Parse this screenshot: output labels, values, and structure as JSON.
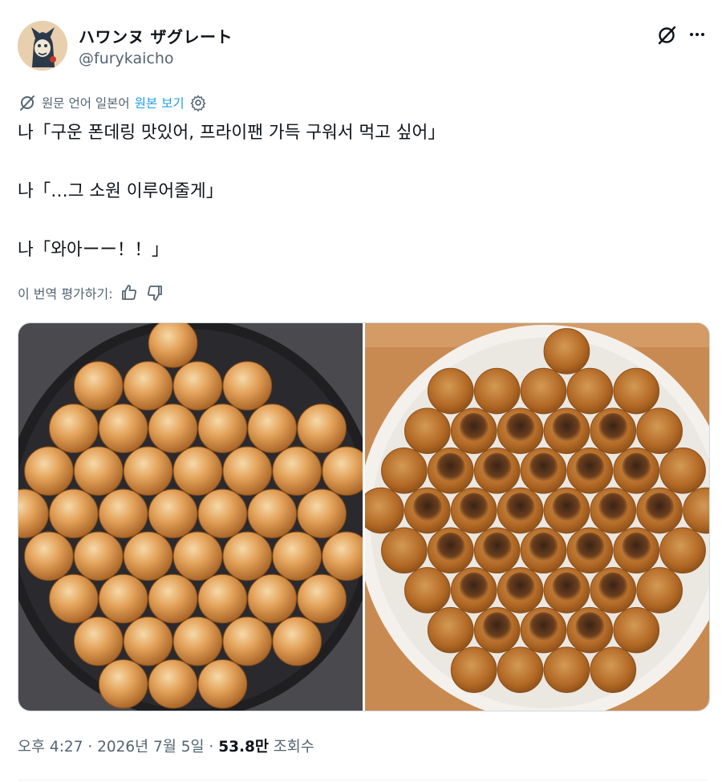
{
  "author": {
    "display_name": "ハワンヌ ザグレート",
    "handle": "@furykaicho",
    "avatar_icon": "avatar-illustration"
  },
  "header_actions": {
    "grok_icon": "grok-icon",
    "more_icon": "more-horizontal-icon"
  },
  "translation": {
    "source_label": "원문 언어 일본어",
    "show_original": "원본 보기",
    "settings_icon": "gear-icon",
    "rate_label": "이 번역 평가하기:",
    "thumbs_up_icon": "thumbs-up-icon",
    "thumbs_down_icon": "thumbs-down-icon"
  },
  "tweet": {
    "lines": [
      "나「구운 폰데링 맛있어, 프라이팬 가득 구워서 먹고 싶어」",
      "나「…그 소원 이루어줄게」",
      "나「와아ーー！！」"
    ]
  },
  "media": {
    "photo_count": 2
  },
  "meta": {
    "time_date": "오후 4:27 · 2026년 7월 5일 · ",
    "views_count": "53.8만",
    "views_label": " 조회수"
  },
  "colors": {
    "text_primary": "#0f1419",
    "text_secondary": "#536471",
    "link_blue": "#1d9bf0",
    "border": "#cfd9de"
  }
}
